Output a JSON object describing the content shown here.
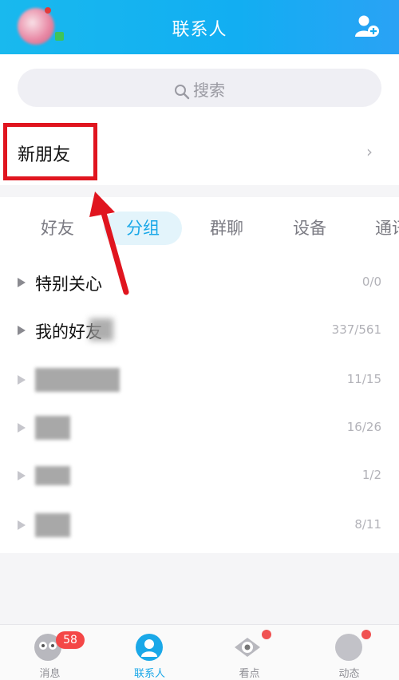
{
  "header": {
    "title": "联系人",
    "accent_color": "#12aef2"
  },
  "search": {
    "placeholder": "搜索"
  },
  "new_friend": {
    "label": "新朋友"
  },
  "tabs": [
    {
      "label": "好友",
      "active": false
    },
    {
      "label": "分组",
      "active": true
    },
    {
      "label": "群聊",
      "active": false
    },
    {
      "label": "设备",
      "active": false
    },
    {
      "label": "通讯",
      "active": false
    }
  ],
  "groups": [
    {
      "name": "特别关心",
      "count": "0/0"
    },
    {
      "name": "我的好友",
      "count": "337/561"
    },
    {
      "name": "",
      "count": "11/15"
    },
    {
      "name": "",
      "count": "16/26"
    },
    {
      "name": "",
      "count": "1/2"
    },
    {
      "name": "",
      "count": "8/11"
    }
  ],
  "bottom_nav": [
    {
      "label": "消息",
      "icon": "message-icon",
      "badge": "58"
    },
    {
      "label": "联系人",
      "icon": "contacts-icon",
      "active": true
    },
    {
      "label": "看点",
      "icon": "eye-icon",
      "dot": true
    },
    {
      "label": "动态",
      "icon": "star-icon",
      "dot": true
    }
  ]
}
